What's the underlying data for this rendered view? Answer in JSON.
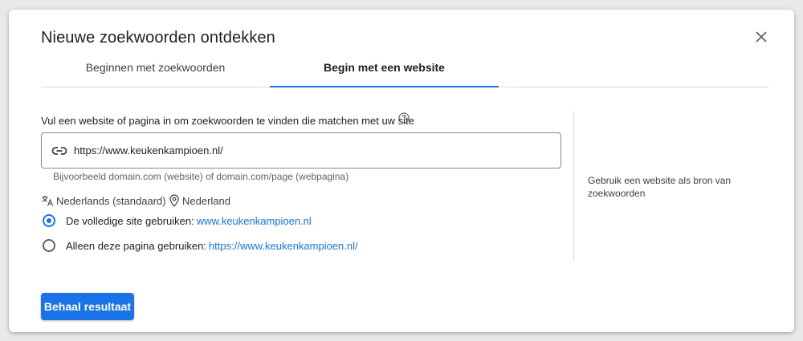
{
  "dialog": {
    "title": "Nieuwe zoekwoorden ontdekken",
    "close_icon": "close-icon"
  },
  "tabs": [
    {
      "label": "Beginnen met zoekwoorden",
      "active": false
    },
    {
      "label": "Begin met een website",
      "active": true
    }
  ],
  "form": {
    "description": "Vul een website of pagina in om zoekwoorden te vinden die matchen met uw site",
    "help_icon": "help-circle-icon",
    "url_value": "https://www.keukenkampioen.nl/",
    "url_icon": "link-icon",
    "hint": "Bijvoorbeeld domain.com (website) of domain.com/page (webpagina)",
    "language": "Nederlands (standaard)",
    "language_icon": "translate-icon",
    "location": "Nederland",
    "location_icon": "location-pin-icon",
    "options": [
      {
        "label": "De volledige site gebruiken:",
        "link": "www.keukenkampioen.nl",
        "selected": true
      },
      {
        "label": "Alleen deze pagina gebruiken:",
        "link": "https://www.keukenkampioen.nl/",
        "selected": false
      }
    ]
  },
  "side_note": "Gebruik een website als bron van zoekwoorden",
  "actions": {
    "submit_label": "Behaal resultaat"
  },
  "colors": {
    "accent": "#1a73e8",
    "text": "#202124",
    "muted": "#5f6368"
  }
}
